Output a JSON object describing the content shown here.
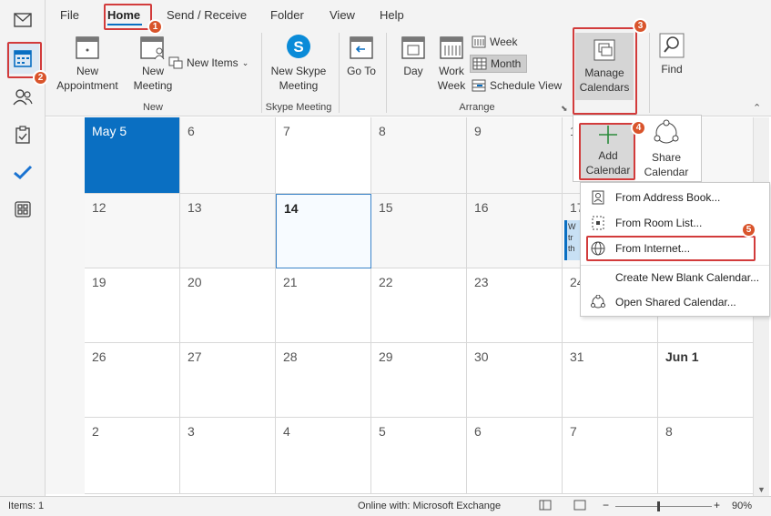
{
  "tabs": [
    "File",
    "Home",
    "Send / Receive",
    "Folder",
    "View",
    "Help"
  ],
  "ribbon": {
    "new_appointment": "New Appointment",
    "new_meeting": "New Meeting",
    "new_items": "New Items",
    "group_new": "New",
    "skype_meeting": "New Skype Meeting",
    "group_skype": "Skype Meeting",
    "goto": "Go To",
    "day": "Day",
    "work_week": "Work Week",
    "week": "Week",
    "month": "Month",
    "schedule_view": "Schedule View",
    "group_arrange": "Arrange",
    "manage_calendars": "Manage Calendars",
    "find": "Find"
  },
  "addcal": {
    "add_calendar": "Add Calendar",
    "share_calendar": "Share Calendar"
  },
  "menu": [
    "From Address Book...",
    "From Room List...",
    "From Internet...",
    "Create New Blank Calendar...",
    "Open Shared Calendar..."
  ],
  "calendar": {
    "rows": [
      [
        "May 5",
        "6",
        "7",
        "8",
        "9",
        "10",
        ""
      ],
      [
        "12",
        "13",
        "14",
        "15",
        "16",
        "17",
        ""
      ],
      [
        "19",
        "20",
        "21",
        "22",
        "23",
        "24",
        ""
      ],
      [
        "26",
        "27",
        "28",
        "29",
        "30",
        "31",
        "Jun 1"
      ],
      [
        "2",
        "3",
        "4",
        "5",
        "6",
        "7",
        "8"
      ]
    ],
    "event_snippet": "W tr th"
  },
  "status": {
    "items": "Items: 1",
    "online": "Online with: Microsoft Exchange",
    "zoom": "90%"
  },
  "badges": [
    "1",
    "2",
    "3",
    "4",
    "5"
  ],
  "colors": {
    "accent": "#0a6fc2",
    "highlight": "#d23b3b",
    "badge": "#d9542b"
  }
}
